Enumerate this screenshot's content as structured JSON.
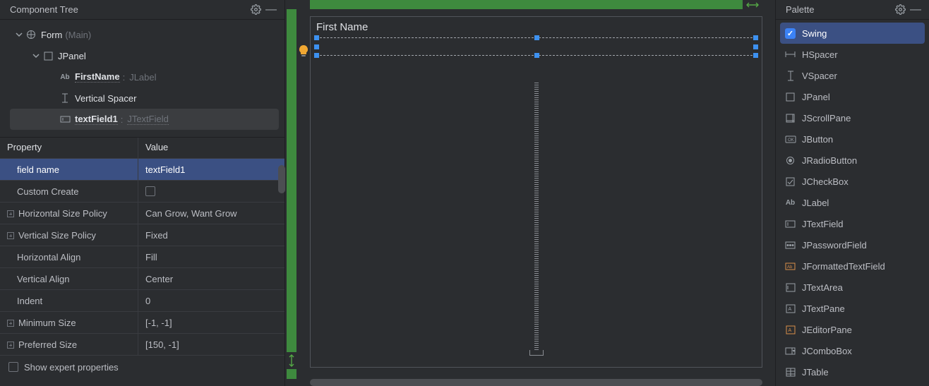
{
  "left": {
    "title": "Component Tree",
    "tree": {
      "form_label": "Form",
      "form_type": "(Main)",
      "jpanel": "JPanel",
      "first_name": "FirstName",
      "first_name_type": "JLabel",
      "vspacer": "Vertical Spacer",
      "textfield_name": "textField1",
      "textfield_type": "JTextField"
    },
    "props": {
      "head_name": "Property",
      "head_val": "Value",
      "rows": [
        {
          "name": "field name",
          "val": "textField1",
          "indent": true,
          "hl": true
        },
        {
          "name": "Custom Create",
          "val": "",
          "indent": true,
          "checkbox": true
        },
        {
          "name": "Horizontal Size Policy",
          "val": "Can Grow, Want Grow",
          "expand": true
        },
        {
          "name": "Vertical Size Policy",
          "val": "Fixed",
          "expand": true
        },
        {
          "name": "Horizontal Align",
          "val": "Fill",
          "indent": true
        },
        {
          "name": "Vertical Align",
          "val": "Center",
          "indent": true
        },
        {
          "name": "Indent",
          "val": "0",
          "indent": true
        },
        {
          "name": "Minimum Size",
          "val": "[-1, -1]",
          "expand": true
        },
        {
          "name": "Preferred Size",
          "val": "[150, -1]",
          "expand": true
        }
      ],
      "expert": "Show expert properties"
    }
  },
  "center": {
    "label_text": "First Name"
  },
  "right": {
    "title": "Palette",
    "items": [
      {
        "label": "Swing",
        "icon": "check",
        "active": true
      },
      {
        "label": "HSpacer",
        "icon": "hspacer"
      },
      {
        "label": "VSpacer",
        "icon": "vspacer"
      },
      {
        "label": "JPanel",
        "icon": "panel"
      },
      {
        "label": "JScrollPane",
        "icon": "scroll"
      },
      {
        "label": "JButton",
        "icon": "button"
      },
      {
        "label": "JRadioButton",
        "icon": "radio"
      },
      {
        "label": "JCheckBox",
        "icon": "checkbox"
      },
      {
        "label": "JLabel",
        "icon": "label"
      },
      {
        "label": "JTextField",
        "icon": "textfield"
      },
      {
        "label": "JPasswordField",
        "icon": "password"
      },
      {
        "label": "JFormattedTextField",
        "icon": "formatted"
      },
      {
        "label": "JTextArea",
        "icon": "textarea"
      },
      {
        "label": "JTextPane",
        "icon": "textpane"
      },
      {
        "label": "JEditorPane",
        "icon": "editorpane"
      },
      {
        "label": "JComboBox",
        "icon": "combo"
      },
      {
        "label": "JTable",
        "icon": "table"
      }
    ]
  }
}
